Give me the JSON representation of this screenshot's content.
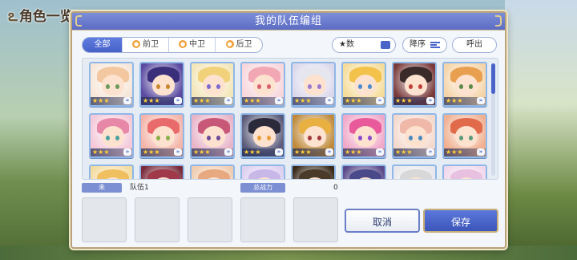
{
  "background": {
    "title": "角色一览"
  },
  "modal": {
    "title": "我的队伍编组"
  },
  "filters": {
    "tabs": [
      {
        "label": "全部",
        "icon": "",
        "active": true
      },
      {
        "label": "前卫",
        "icon": "role-front-icon",
        "active": false
      },
      {
        "label": "中卫",
        "icon": "role-middle-icon",
        "active": false
      },
      {
        "label": "后卫",
        "icon": "role-back-icon",
        "active": false
      }
    ],
    "sort_key": "★数",
    "sort_order": "降序",
    "callout": "呼出"
  },
  "roster": {
    "rows": [
      [
        {
          "stars": "★★★",
          "hair": "#f3c7a0",
          "eye": "#6a9a5a",
          "bg": "#f6e6d8"
        },
        {
          "stars": "★★★",
          "hair": "#3a2f7a",
          "eye": "#c9872e",
          "bg": "#5b4aa0"
        },
        {
          "stars": "★★★",
          "hair": "#f1d27a",
          "eye": "#7a6ad0",
          "bg": "#f3e6b8"
        },
        {
          "stars": "★★★",
          "hair": "#f2a8b4",
          "eye": "#d86070",
          "bg": "#f7d6dc"
        },
        {
          "stars": "★★★",
          "hair": "#e6e6ee",
          "eye": "#9a7ad0",
          "bg": "#dcd8ec"
        },
        {
          "stars": "★★★",
          "hair": "#f2c24a",
          "eye": "#4a8ad0",
          "bg": "#f6dc9a"
        },
        {
          "stars": "★★★",
          "hair": "#3a2a2a",
          "eye": "#c0403a",
          "bg": "#7a3a3a"
        },
        {
          "stars": "★★★",
          "hair": "#e8a050",
          "eye": "#5a8a4a",
          "bg": "#f4d4a8"
        }
      ],
      [
        {
          "stars": "★★★",
          "hair": "#e888a8",
          "eye": "#4aa0a0",
          "bg": "#f4c8d8"
        },
        {
          "stars": "★★★",
          "hair": "#e86a6a",
          "eye": "#8ab04a",
          "bg": "#f4b4a8"
        },
        {
          "stars": "★★★",
          "hair": "#c85878",
          "eye": "#6a4a9a",
          "bg": "#e8b4c8"
        },
        {
          "stars": "★★★",
          "hair": "#2a2a3a",
          "eye": "#e8a03a",
          "bg": "#5a5a7a"
        },
        {
          "stars": "★★★",
          "hair": "#e8b040",
          "eye": "#a03a3a",
          "bg": "#c08a3a"
        },
        {
          "stars": "★★★",
          "hair": "#e85a9a",
          "eye": "#8a4ad0",
          "bg": "#f0a8c8"
        },
        {
          "stars": "★★★",
          "hair": "#f0b8a8",
          "eye": "#4a8ac0",
          "bg": "#f4d8cc"
        },
        {
          "stars": "★★★",
          "hair": "#e06a4a",
          "eye": "#5a9a7a",
          "bg": "#f0b090"
        }
      ],
      [
        {
          "stars": "",
          "hair": "#f0c060",
          "eye": "#6a8ad0",
          "bg": "#f4dca0"
        },
        {
          "stars": "",
          "hair": "#a03a4a",
          "eye": "#4a4a9a",
          "bg": "#7a2a3a"
        },
        {
          "stars": "",
          "hair": "#e8a880",
          "eye": "#6a6aa0",
          "bg": "#f0ccb0"
        },
        {
          "stars": "",
          "hair": "#c8b8e8",
          "eye": "#6a5aa0",
          "bg": "#dcd0f0"
        },
        {
          "stars": "",
          "hair": "#4a3a2a",
          "eye": "#a07a3a",
          "bg": "#3a2a1a"
        },
        {
          "stars": "",
          "hair": "#4a4a8a",
          "eye": "#c0a040",
          "bg": "#5a4a8a"
        },
        {
          "stars": "",
          "hair": "#d8d8d8",
          "eye": "#7a7a9a",
          "bg": "#e8e8ec"
        },
        {
          "stars": "",
          "hair": "#e8c0e0",
          "eye": "#9a6ac0",
          "bg": "#f0d8ec"
        }
      ]
    ]
  },
  "team": {
    "tag": "未",
    "name": "队伍1",
    "power_label": "总战力",
    "power_value": "0",
    "slots": 5
  },
  "buttons": {
    "cancel": "取消",
    "save": "保存"
  }
}
